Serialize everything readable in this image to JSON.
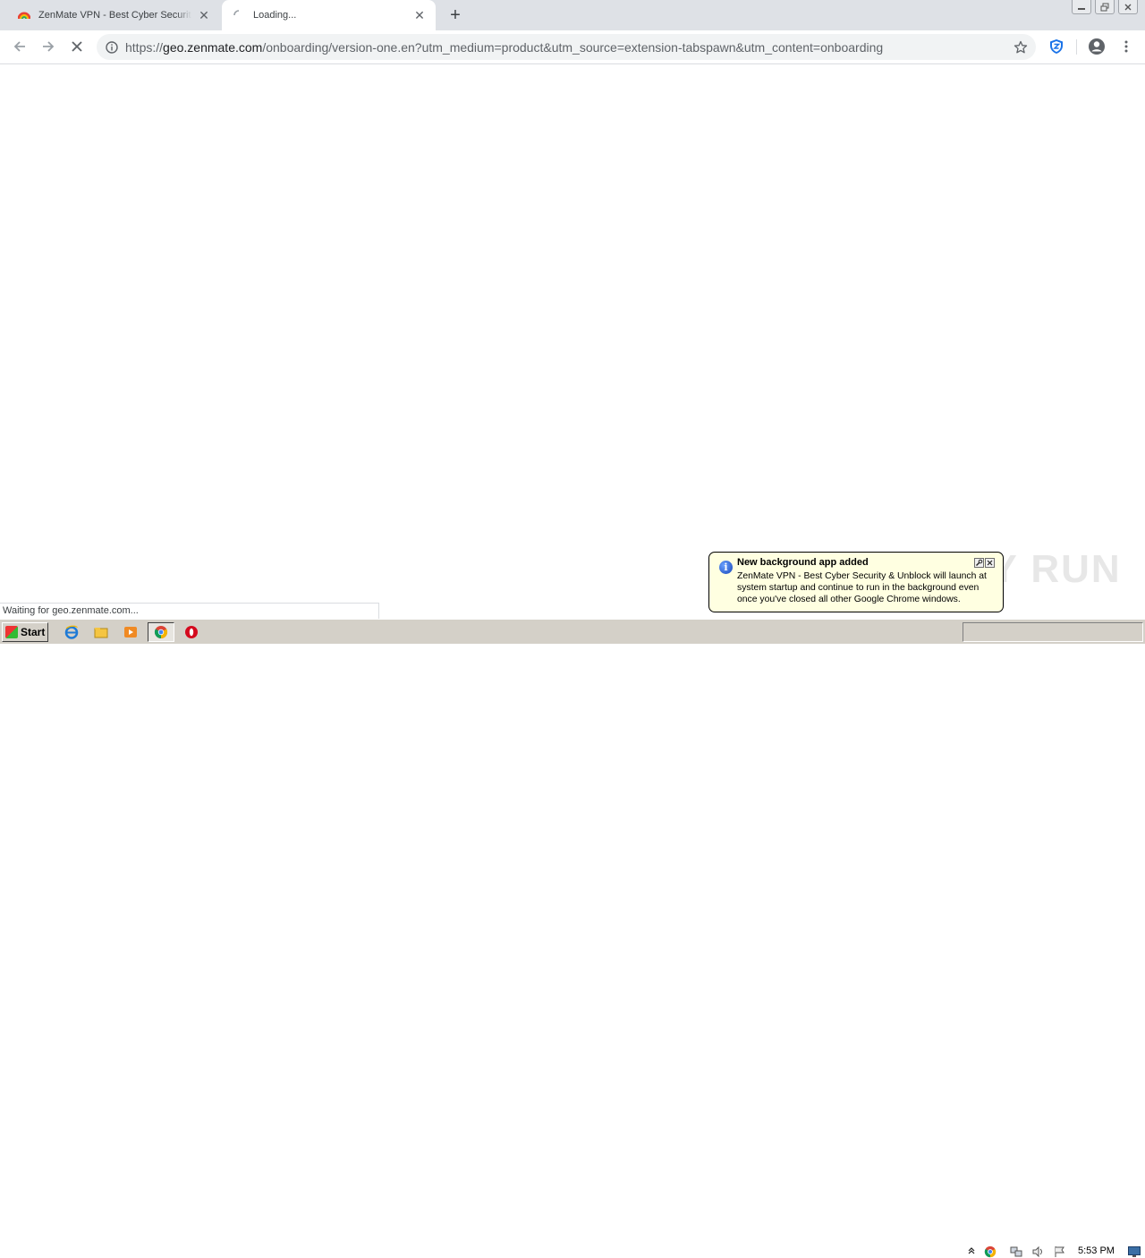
{
  "browser": {
    "tabs": [
      {
        "title": "ZenMate VPN - Best Cyber Security & Unblock",
        "active": false
      },
      {
        "title": "Loading...",
        "active": true
      }
    ],
    "new_tab_label": "+",
    "address": {
      "scheme": "https://",
      "host": "geo.zenmate.com",
      "path": "/onboarding/version-one.en?utm_medium=product&utm_source=extension-tabspawn&utm_content=onboarding"
    },
    "status_text": "Waiting for geo.zenmate.com..."
  },
  "notification": {
    "title": "New background app added",
    "body": "ZenMate VPN - Best Cyber Security & Unblock will launch at system startup and continue to run in the background even once you've closed all other Google Chrome windows."
  },
  "taskbar": {
    "start_label": "Start",
    "clock": "5:53 PM"
  },
  "watermark": "ANY RUN",
  "colors": {
    "tabstrip": "#dee1e6",
    "balloon": "#ffffe1",
    "taskbar": "#d4d0c8",
    "zenmate_shield": "#1a73e8"
  }
}
